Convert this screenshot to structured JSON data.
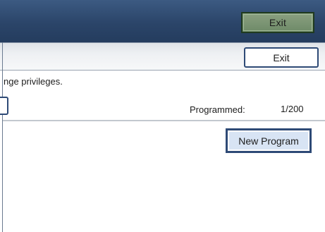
{
  "header": {
    "exit_label": "Exit"
  },
  "toolbar": {
    "exit_label": "Exit"
  },
  "message": {
    "text": "nge privileges."
  },
  "programmed": {
    "label": "Programmed:",
    "count": "1/200"
  },
  "actions": {
    "new_program_label": "New Program"
  },
  "colors": {
    "header_bg": "#2b4569",
    "header_exit_bg": "#6e8a68",
    "button_border": "#2e4a76",
    "new_program_bg": "#d8e4f4"
  }
}
